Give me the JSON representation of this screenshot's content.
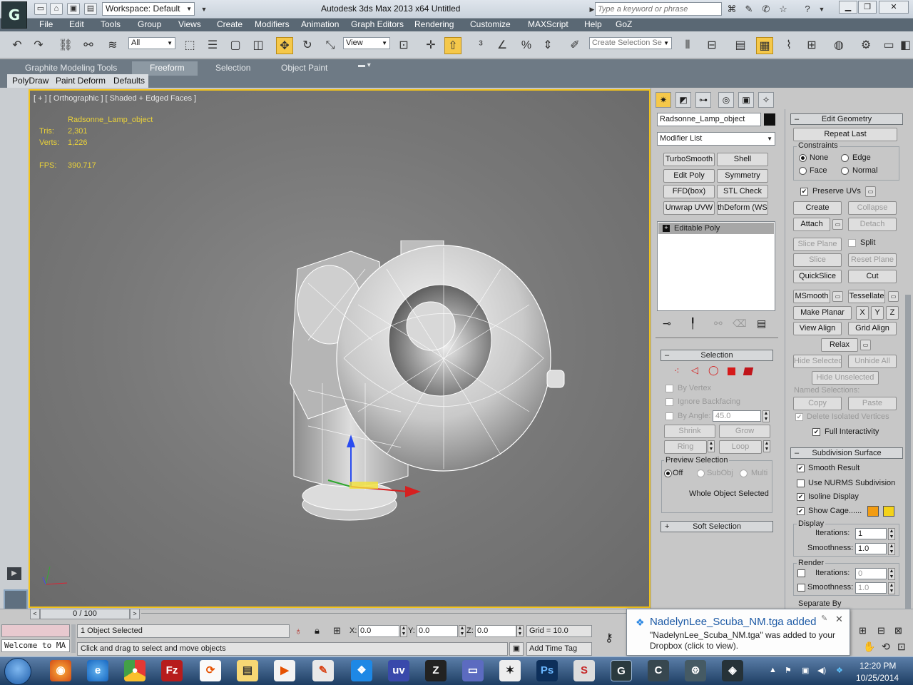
{
  "titlebar": {
    "app_logo": "G",
    "workspace": "Workspace: Default",
    "title": "Autodesk 3ds Max  2013 x64      Untitled",
    "search_placeholder": "Type a keyword or phrase",
    "help_label": "?"
  },
  "menu": [
    "File",
    "Edit",
    "Tools",
    "Group",
    "Views",
    "Create",
    "Modifiers",
    "Animation",
    "Graph Editors",
    "Rendering",
    "Customize",
    "MAXScript",
    "Help",
    "GoZ"
  ],
  "toolbar": {
    "selection_filter": "All",
    "reference_coord": "View",
    "named_selection_placeholder": "Create Selection Se"
  },
  "ribbon": {
    "tabs": [
      "Graphite Modeling Tools",
      "Freeform",
      "Selection",
      "Object Paint"
    ],
    "active_tab": "Freeform",
    "subtabs": [
      "PolyDraw",
      "Paint Deform",
      "Defaults"
    ]
  },
  "viewport": {
    "label": "[ + ] [ Orthographic ] [ Shaded + Edged Faces ]",
    "object_name": "Radsonne_Lamp_object",
    "tris_label": "Tris:",
    "tris_value": "2,301",
    "verts_label": "Verts:",
    "verts_value": "1,226",
    "fps_label": "FPS:",
    "fps_value": "390.717"
  },
  "command_panel": {
    "object_name": "Radsonne_Lamp_object",
    "modifier_list": "Modifier List",
    "modifier_buttons": [
      "TurboSmooth",
      "Shell",
      "Edit Poly",
      "Symmetry",
      "FFD(box)",
      "STL Check",
      "Unwrap UVW",
      "thDeform (WSI"
    ],
    "stack_item": "Editable Poly",
    "selection": {
      "title": "Selection",
      "by_vertex": "By Vertex",
      "ignore_backfacing": "Ignore Backfacing",
      "by_angle": "By Angle:",
      "angle_value": "45.0",
      "shrink": "Shrink",
      "grow": "Grow",
      "ring": "Ring",
      "loop": "Loop",
      "preview_selection": "Preview Selection",
      "off": "Off",
      "subobj": "SubObj",
      "multi": "Multi",
      "status": "Whole Object Selected"
    },
    "soft_selection": "Soft Selection",
    "edit_geometry": {
      "title": "Edit Geometry",
      "repeat_last": "Repeat Last",
      "constraints": "Constraints",
      "none": "None",
      "edge": "Edge",
      "face": "Face",
      "normal": "Normal",
      "preserve_uvs": "Preserve UVs",
      "create": "Create",
      "collapse": "Collapse",
      "attach": "Attach",
      "detach": "Detach",
      "slice_plane": "Slice Plane",
      "split": "Split",
      "slice": "Slice",
      "reset_plane": "Reset Plane",
      "quickslice": "QuickSlice",
      "cut": "Cut",
      "msmooth": "MSmooth",
      "tessellate": "Tessellate",
      "make_planar": "Make Planar",
      "x": "X",
      "y": "Y",
      "z": "Z",
      "view_align": "View Align",
      "grid_align": "Grid Align",
      "relax": "Relax",
      "hide_selected": "Hide Selected",
      "unhide_all": "Unhide All",
      "hide_unselected": "Hide Unselected",
      "named_selections": "Named Selections:",
      "copy": "Copy",
      "paste": "Paste",
      "delete_isolated": "Delete Isolated Vertices",
      "full_interactivity": "Full Interactivity"
    },
    "subdivision": {
      "title": "Subdivision Surface",
      "smooth_result": "Smooth Result",
      "use_nurms": "Use NURMS Subdivision",
      "isoline": "Isoline Display",
      "show_cage": "Show Cage......",
      "display": "Display",
      "iterations_label": "Iterations:",
      "iterations_value": "1",
      "smoothness_label": "Smoothness:",
      "smoothness_value": "1.0",
      "render": "Render",
      "render_iterations": "0",
      "render_smoothness": "1.0",
      "separate_by": "Separate By"
    },
    "cage_colors": [
      "#f29c12",
      "#f3d21a"
    ]
  },
  "status": {
    "time_slider": "0 / 100",
    "maxscript_welcome": "Welcome to MA",
    "selected": "1 Object Selected",
    "prompt": "Click and drag to select and move objects",
    "x_label": "X:",
    "x_value": "0.0",
    "y_label": "Y:",
    "y_value": "0.0",
    "z_label": "Z:",
    "z_value": "0.0",
    "grid": "Grid = 10.0",
    "add_time_tag": "Add Time Tag"
  },
  "toast": {
    "title": "NadelynLee_Scuba_NM.tga added",
    "body": "\"NadelynLee_Scuba_NM.tga\" was added to your Dropbox (click to view)."
  },
  "taskbar": {
    "time": "12:20 PM",
    "date": "10/25/2014"
  }
}
